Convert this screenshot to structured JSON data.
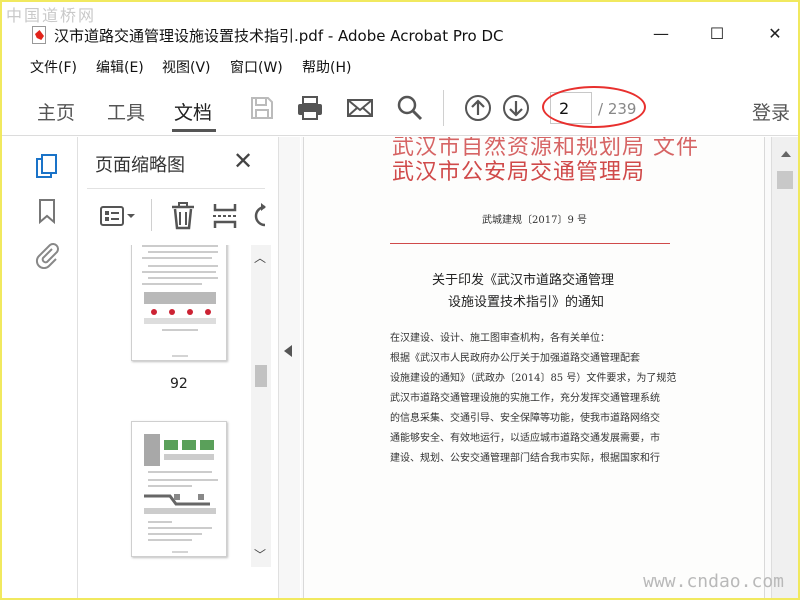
{
  "watermark_top": "中国道桥网",
  "watermark_bottom": "www.cndao.com",
  "window": {
    "title": "汉市道路交通管理设施设置技术指引.pdf - Adobe Acrobat Pro DC",
    "minimize": "—",
    "maximize": "☐",
    "close": "✕"
  },
  "menu": [
    "文件(F)",
    "编辑(E)",
    "视图(V)",
    "窗口(W)",
    "帮助(H)"
  ],
  "nav": {
    "home": "主页",
    "tools": "工具",
    "document": "文档",
    "login": "登录"
  },
  "page_nav": {
    "current": "2",
    "total": "/ 239"
  },
  "panel": {
    "title": "页面缩略图",
    "close": "✕",
    "thumbnails": [
      {
        "label": "92"
      },
      {
        "label": ""
      }
    ]
  },
  "document": {
    "header_line1": "武汉市自然资源和规划局 文件",
    "header_line2": "武汉市公安局交通管理局",
    "doc_number": "武城建规〔2017〕9 号",
    "title_line1": "关于印发《武汉市道路交通管理",
    "title_line2": "设施设置技术指引》的通知",
    "body": [
      "在汉建设、设计、施工图审查机构，各有关单位：",
      "    根据《武汉市人民政府办公厅关于加强道路交通管理配套",
      "设施建设的通知》（武政办〔2014〕85 号）文件要求，为了规范",
      "武汉市道路交通管理设施的实施工作，充分发挥交通管理系统",
      "的信息采集、交通引导、安全保障等功能，使我市道路网络交",
      "通能够安全、有效地运行，以适应城市道路交通发展需要，市",
      "建设、规划、公安交通管理部门结合我市实际，根据国家和行"
    ]
  },
  "colors": {
    "accent_red": "#e8302e",
    "doc_red": "#d04a4a",
    "background_frame": "#f1e95f"
  }
}
